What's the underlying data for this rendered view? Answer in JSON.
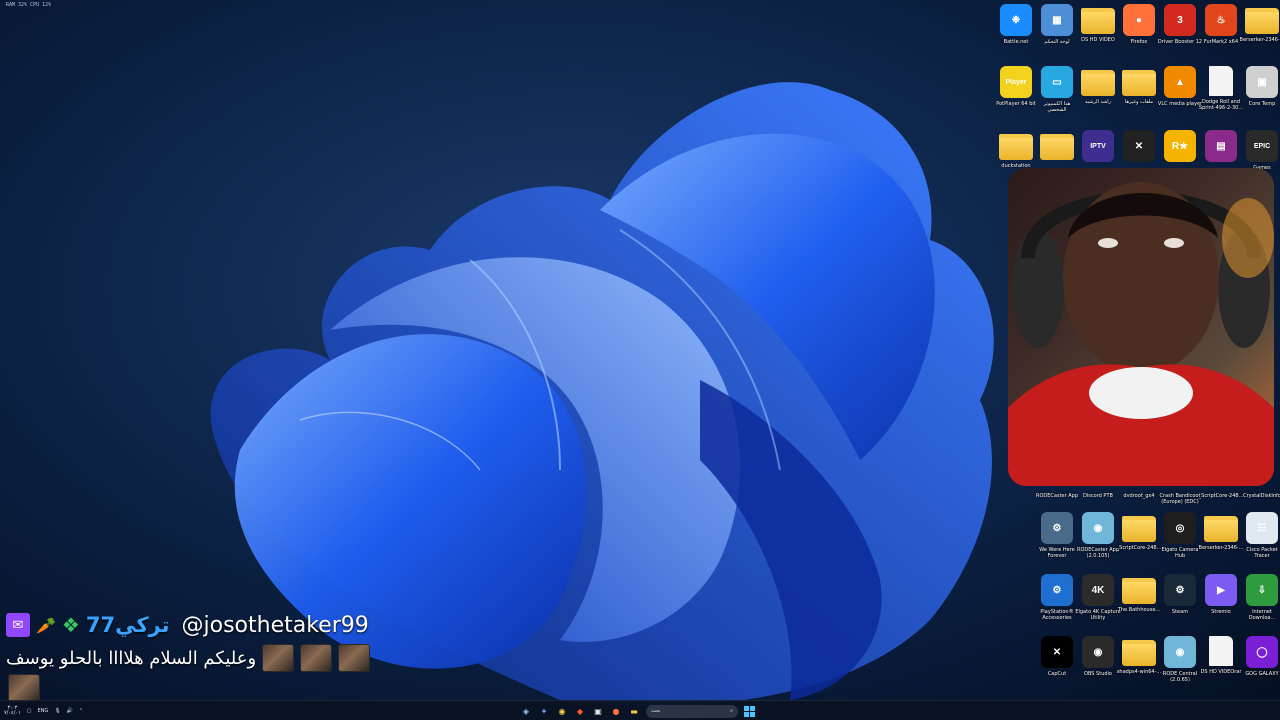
{
  "sysinfo": {
    "text": "RAM 32%  CPU 12%"
  },
  "desktop": {
    "icons": [
      {
        "label": "Battle.net",
        "icon": "battlenet-icon",
        "color": "#1a8cff",
        "glyph": "❉"
      },
      {
        "label": "لوحة التحكم",
        "icon": "control-panel-icon",
        "color": "#4c8fd6",
        "glyph": "▦"
      },
      {
        "label": "DS HD VIDEO",
        "icon": "folder-icon",
        "type": "folder"
      },
      {
        "label": "Firefox",
        "icon": "firefox-icon",
        "color": "#ff7139",
        "glyph": "●"
      },
      {
        "label": "Driver Booster 12",
        "icon": "driver-booster-icon",
        "color": "#d22a1e",
        "glyph": "3"
      },
      {
        "label": "FurMark2 x64",
        "icon": "furmark-icon",
        "color": "#e2441b",
        "glyph": "♨"
      },
      {
        "label": "Berserker-2346-...",
        "icon": "folder-icon",
        "type": "folder"
      },
      {
        "label": "PotPlayer 64 bit",
        "icon": "potplayer-icon",
        "color": "#f2d21c",
        "glyph": "Player"
      },
      {
        "label": "هذا الكمبيوتر الشخصي",
        "icon": "this-pc-icon",
        "color": "#28a8e0",
        "glyph": "▭"
      },
      {
        "label": "راشد الرشيد",
        "icon": "user-folder-icon",
        "type": "folder"
      },
      {
        "label": "ملفات وغيرها",
        "icon": "folder-icon",
        "type": "folder"
      },
      {
        "label": "VLC media player",
        "icon": "vlc-icon",
        "color": "#f28a00",
        "glyph": "▲"
      },
      {
        "label": "Dodge Roll and Sprint-496-2-30...",
        "icon": "document-icon",
        "type": "doc"
      },
      {
        "label": "Core Temp",
        "icon": "core-temp-icon",
        "color": "#cfcfcf",
        "glyph": "▣"
      },
      {
        "label": "duckstation",
        "icon": "folder-icon",
        "type": "folder"
      },
      {
        "label": "",
        "icon": "folder-icon",
        "type": "folder"
      },
      {
        "label": "",
        "icon": "iptv-smarters-icon",
        "color": "#3f2d8f",
        "glyph": "IPTV"
      },
      {
        "label": "",
        "icon": "capcut-alt-icon",
        "color": "#222222",
        "glyph": "✕"
      },
      {
        "label": "",
        "icon": "rockstar-icon",
        "color": "#f5b400",
        "glyph": "R★"
      },
      {
        "label": "",
        "icon": "winrar-icon",
        "color": "#8a2a8a",
        "glyph": "▤"
      },
      {
        "label": "Games",
        "icon": "epic-games-icon",
        "color": "#2a2a2a",
        "glyph": "EPIC"
      },
      {
        "label": "RODECaster App",
        "icon": "rodecaster-icon",
        "type": "hidden"
      },
      {
        "label": "Discord PTB",
        "icon": "discord-icon",
        "type": "hidden"
      },
      {
        "label": "dvdroot_gx4",
        "icon": "dvd-icon",
        "type": "hidden"
      },
      {
        "label": "Crash Bandicoot (Europe) (EDC)",
        "icon": "crash-icon",
        "type": "hidden"
      },
      {
        "label": "_ScriptCore-248...",
        "icon": "folder-icon",
        "type": "hidden"
      },
      {
        "label": "CrystalDiskInfo",
        "icon": "crystaldisk-icon",
        "type": "hidden"
      },
      {
        "label": "We Were Here Forever",
        "icon": "we-were-here-icon",
        "color": "#4a6a8a",
        "glyph": "⚙"
      },
      {
        "label": "RODECaster App (2.0.105)",
        "icon": "rodecaster-disc-icon",
        "color": "#6fb6d8",
        "glyph": "◉"
      },
      {
        "label": "_ScriptCore-248...",
        "icon": "folder-icon",
        "type": "folder"
      },
      {
        "label": "Elgato Camera Hub",
        "icon": "elgato-camera-icon",
        "color": "#1e1e1e",
        "glyph": "◎"
      },
      {
        "label": "Berserker-2346-...",
        "icon": "folder-zip-icon",
        "type": "folder"
      },
      {
        "label": "Cisco Packet Tracer",
        "icon": "cisco-icon",
        "color": "#dfe9ef",
        "glyph": "☷"
      },
      {
        "label": "PlayStation® Accessories",
        "icon": "playstation-icon",
        "color": "#1f6fd0",
        "glyph": "⚙"
      },
      {
        "label": "Elgato 4K Capture Utility",
        "icon": "elgato-4k-icon",
        "color": "#2b2b2b",
        "glyph": "4K"
      },
      {
        "label": "The.Bathhouse...",
        "icon": "folder-icon",
        "type": "folder"
      },
      {
        "label": "Steam",
        "icon": "steam-icon",
        "color": "#1b2838",
        "glyph": "⚙"
      },
      {
        "label": "Stremio",
        "icon": "stremio-icon",
        "color": "#7b5bf2",
        "glyph": "▶"
      },
      {
        "label": "Internet Downloa...",
        "icon": "idm-icon",
        "color": "#2e9b3e",
        "glyph": "⇩"
      },
      {
        "label": "CapCut",
        "icon": "capcut-icon",
        "color": "#000000",
        "glyph": "✕"
      },
      {
        "label": "OBS Studio",
        "icon": "obs-icon",
        "color": "#2a2a2a",
        "glyph": "◉"
      },
      {
        "label": "shadps4-win64-...",
        "icon": "shadps4-folder-icon",
        "type": "folder"
      },
      {
        "label": "RODE Central (2.0.65)",
        "icon": "rode-central-icon",
        "color": "#6fb6d8",
        "glyph": "◉"
      },
      {
        "label": "DS HD VIDEOrar",
        "icon": "document-icon",
        "type": "doc"
      },
      {
        "label": "GOG GALAXY",
        "icon": "gog-icon",
        "color": "#7a1fd6",
        "glyph": "◯"
      }
    ]
  },
  "chat": {
    "badge_icon": "carrot-badge-icon",
    "gift_icon": "gift-icon",
    "username": "تركي77",
    "mention": "@josothetaker99",
    "message": "وعليكم السلام هلاااا بالحلو يوسف"
  },
  "taskbar": {
    "time": "٣:٠٣",
    "date": "٧/٠٤/٠١",
    "lang": "ENG",
    "search_placeholder": "بحث",
    "colors": {
      "accent": "#4cc2ff",
      "twitch": "#9146ff",
      "username": "#3aa3ff"
    }
  }
}
